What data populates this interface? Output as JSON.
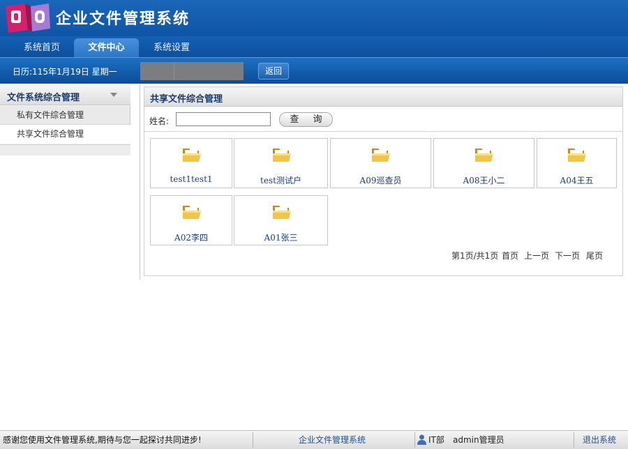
{
  "app": {
    "title": "企业文件管理系统",
    "colors": {
      "brand_blue": "#0f55a6",
      "tab_active": "#2b77c9",
      "link_blue": "#1c3f7a"
    }
  },
  "nav": {
    "tabs": [
      {
        "label": "系统首页"
      },
      {
        "label": "文件中心",
        "active": true
      },
      {
        "label": "系统设置"
      }
    ]
  },
  "infobar": {
    "date_text": "日历:115年1月19日 星期一",
    "back_label": "返回"
  },
  "sidebar": {
    "title": "文件系统综合管理",
    "caret_icon": "caret-down-icon",
    "items": [
      {
        "label": "私有文件综合管理"
      },
      {
        "label": "共享文件综合管理"
      }
    ]
  },
  "main": {
    "title": "共享文件综合管理",
    "search": {
      "label": "姓名:",
      "value": "",
      "button_label": "查 询"
    },
    "folder_icon": "folder-open-icon",
    "folders": [
      {
        "name": "test1test1"
      },
      {
        "name": "test测试户"
      },
      {
        "name": "A09巡查员"
      },
      {
        "name": "A08王小二"
      },
      {
        "name": "A04王五"
      },
      {
        "name": "A02李四"
      },
      {
        "name": "A01张三"
      }
    ],
    "pager": {
      "info": "第1页/共1页",
      "first": "首页",
      "prev": "上一页",
      "next": "下一页",
      "last": "尾页"
    }
  },
  "statusbar": {
    "message": "感谢您使用文件管理系统,期待与您一起探讨共同进步!",
    "system_name": "企业文件管理系统",
    "user_icon": "user-icon",
    "department": "IT部",
    "user": "admin管理员",
    "logout": "退出系统"
  }
}
